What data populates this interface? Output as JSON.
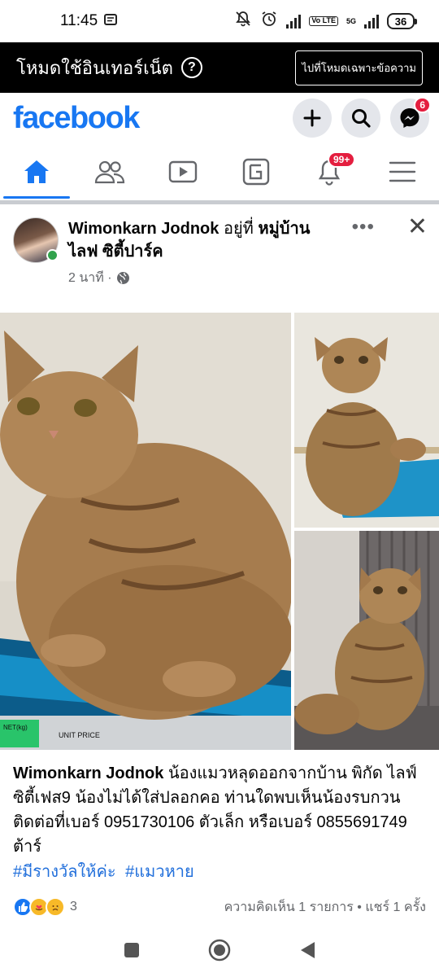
{
  "status_bar": {
    "time": "11:45",
    "battery": "36",
    "network_label_top": "5G",
    "lte_label": "Vo LTE"
  },
  "free_mode": {
    "label": "โหมดใช้อินเทอร์เน็ต",
    "help_symbol": "?",
    "button_label": "ไปที่โหมดเฉพาะข้อความ"
  },
  "header": {
    "logo": "facebook",
    "messenger_badge": "6"
  },
  "tabs": [
    {
      "name": "home",
      "icon": "home-icon",
      "active": true
    },
    {
      "name": "friends",
      "icon": "friends-icon",
      "active": false
    },
    {
      "name": "watch",
      "icon": "video-icon",
      "active": false
    },
    {
      "name": "groups",
      "icon": "groups-icon",
      "active": false
    },
    {
      "name": "notifications",
      "icon": "bell-icon",
      "active": false,
      "badge": "99+"
    },
    {
      "name": "menu",
      "icon": "hamburger-icon",
      "active": false
    }
  ],
  "post": {
    "author": "Wimonkarn Jodnok",
    "location_prefix": "อยู่ที่",
    "location_line1": "หมู่บ้าน",
    "location_line2": "ไลฟ ซิตี้ปาร์ค",
    "time": "2 นาที ·",
    "text": "น้องแมวหลุดออกจากบ้าน พิกัด ไลฟ์ซิตี้เฟส9 น้องไม่ได้ใส่ปลอกคอ ท่านใดพบเห็นน้องรบกวนติดต่อที่เบอร์ 0951730106 ตัวเล็ก หรือเบอร์ 0855691749 ต้าร์",
    "hashtags": [
      "#มีรางวัลให้ค่ะ",
      "#แมวหาย"
    ],
    "photo_labels": [
      "NET(kg)",
      "UNIT PRICE"
    ],
    "reaction_count": "3",
    "engagement": "ความคิดเห็น 1 รายการ • แชร์ 1 ครั้ง"
  },
  "colors": {
    "brand": "#1877f2",
    "badge_red": "#e41e3f",
    "online_green": "#31a24c",
    "hashtag": "#216fdb",
    "muted": "#65676b"
  }
}
